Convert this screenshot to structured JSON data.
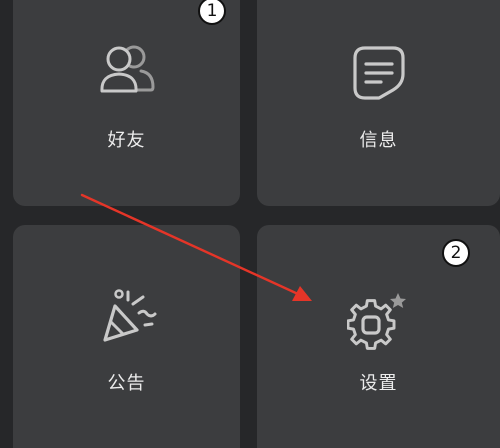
{
  "tiles": {
    "friends": {
      "label": "好友",
      "icon": "friends-icon"
    },
    "messages": {
      "label": "信息",
      "icon": "message-icon"
    },
    "notice": {
      "label": "公告",
      "icon": "party-popper-icon"
    },
    "settings": {
      "label": "设置",
      "icon": "gear-icon"
    }
  },
  "annotations": {
    "step1": "1",
    "step2": "2",
    "arrow_color": "#e53528"
  },
  "colors": {
    "background": "#262729",
    "tile": "#3c3d3f",
    "icon_stroke": "#c9c9c9",
    "label": "#ececec"
  }
}
